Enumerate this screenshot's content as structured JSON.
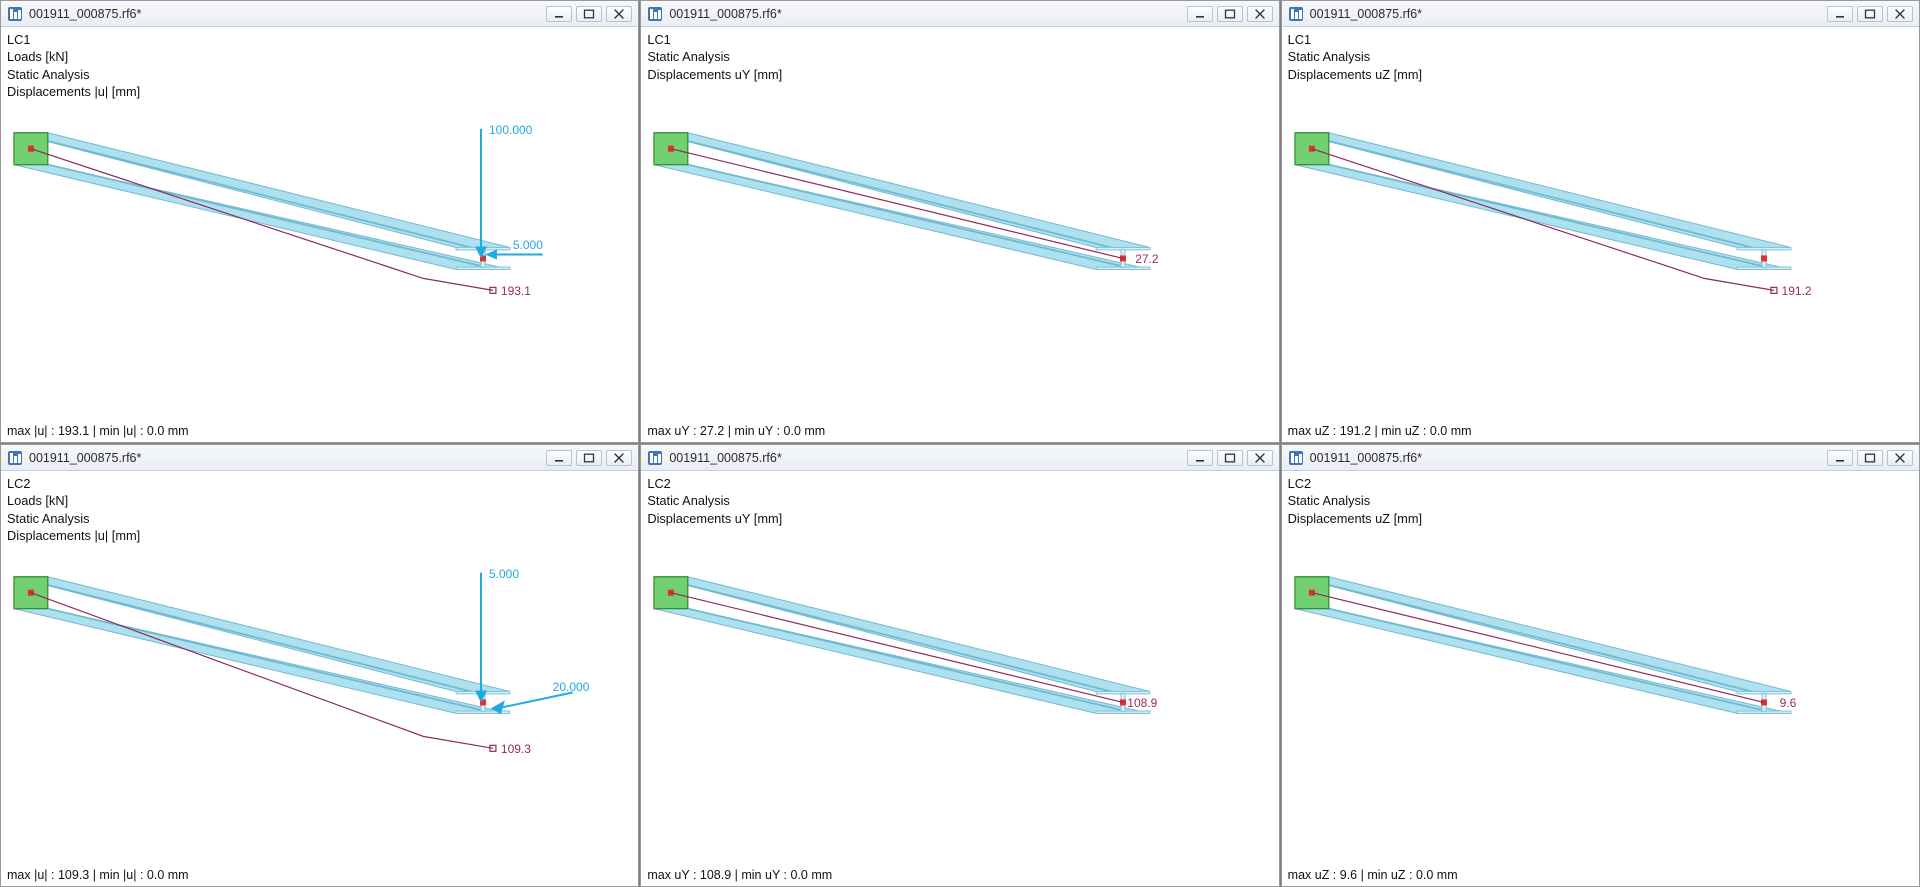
{
  "common": {
    "title": "001911_000875.rf6*"
  },
  "panes": [
    {
      "id": "p1",
      "info": [
        "LC1",
        "Loads [kN]",
        "Static Analysis",
        "Displacements |u| [mm]"
      ],
      "status": "max |u| : 193.1 | min |u| : 0.0 mm",
      "labels": {
        "load_v": "100.000",
        "load_h": "5.000",
        "disp": "193.1"
      },
      "arrows": {
        "vertical": true,
        "horizontal": "right"
      },
      "disp_offset": true
    },
    {
      "id": "p2",
      "info": [
        "LC1",
        "Static Analysis",
        "Displacements uY [mm]"
      ],
      "status": "max uY : 27.2 | min uY : 0.0 mm",
      "labels": {
        "disp": "27.2"
      },
      "arrows": {},
      "disp_offset": false,
      "disp_at_tip": true,
      "disp_xoff": 12
    },
    {
      "id": "p3",
      "info": [
        "LC1",
        "Static Analysis",
        "Displacements uZ [mm]"
      ],
      "status": "max uZ : 191.2 | min uZ : 0.0 mm",
      "labels": {
        "disp": "191.2"
      },
      "arrows": {},
      "disp_offset": true
    },
    {
      "id": "p4",
      "info": [
        "LC2",
        "Loads [kN]",
        "Static Analysis",
        "Displacements |u| [mm]"
      ],
      "status": "max |u| : 109.3 | min |u| : 0.0 mm",
      "labels": {
        "load_v": "5.000",
        "load_h": "20.000",
        "disp": "109.3"
      },
      "arrows": {
        "vertical": true,
        "horizontal": "left"
      },
      "disp_offset": true,
      "disp_yoff": 14
    },
    {
      "id": "p5",
      "info": [
        "LC2",
        "Static Analysis",
        "Displacements uY [mm]"
      ],
      "status": "max uY : 108.9 | min uY : 0.0 mm",
      "labels": {
        "disp": "108.9"
      },
      "arrows": {},
      "disp_offset": false,
      "disp_at_tip": true,
      "disp_xoff": 4
    },
    {
      "id": "p6",
      "info": [
        "LC2",
        "Static Analysis",
        "Displacements uZ [mm]"
      ],
      "status": "max uZ : 9.6 | min uZ : 0.0 mm",
      "labels": {
        "disp": "9.6"
      },
      "arrows": {},
      "disp_offset": false,
      "disp_at_tip": true,
      "disp_xoff": 16
    }
  ]
}
